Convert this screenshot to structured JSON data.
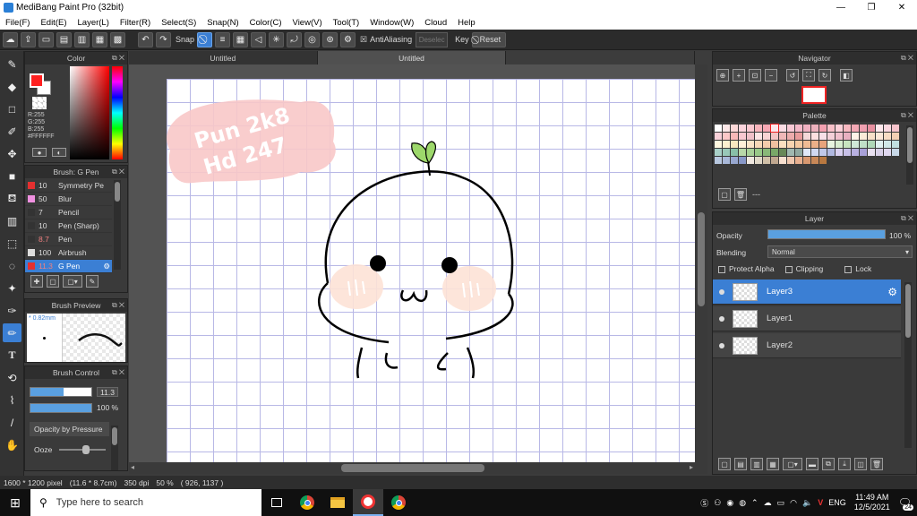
{
  "window": {
    "title": "MediBang Paint Pro (32bit)",
    "controls": [
      "—",
      "❐",
      "✕"
    ]
  },
  "menu": [
    "File(F)",
    "Edit(E)",
    "Layer(L)",
    "Filter(R)",
    "Select(S)",
    "Snap(N)",
    "Color(C)",
    "View(V)",
    "Tool(T)",
    "Window(W)",
    "Cloud",
    "Help"
  ],
  "toolbar": {
    "snap_label": "Snap",
    "antialias_label": "AntiAliasing",
    "deselect_label": "Deselec",
    "key_label": "Key",
    "reset_label": "Reset"
  },
  "tabs": [
    "Untitled",
    "Untitled"
  ],
  "color_panel": {
    "title": "Color",
    "r": "R:255",
    "g": "G:255",
    "b": "B:255",
    "hex": "#FFFFFF",
    "primary": "#ff2020",
    "secondary": "#ffffff"
  },
  "brush_panel": {
    "title": "Brush: G Pen",
    "brushes": [
      {
        "size": "10",
        "name": "Symmetry Pe",
        "color": "#e53030"
      },
      {
        "size": "50",
        "name": "Blur",
        "color": "#f090e0"
      },
      {
        "size": "7",
        "name": "Pencil",
        "color": "#333333"
      },
      {
        "size": "10",
        "name": "Pen (Sharp)",
        "color": "#333333"
      },
      {
        "size": "8.7",
        "name": "Pen",
        "color": "#333333"
      },
      {
        "size": "100",
        "name": "Airbrush",
        "color": "#dddddd"
      },
      {
        "size": "11.3",
        "name": "G Pen",
        "color": "#e53030"
      }
    ]
  },
  "brush_preview": {
    "title": "Brush Preview",
    "size": "* 0.82mm"
  },
  "brush_control": {
    "title": "Brush Control",
    "size_value": "11.3",
    "size_fraction": 0.55,
    "opacity_value": "100 %",
    "opacity_fraction": 1.0,
    "pressure_label": "Opacity by Pressure",
    "ooze_label": "Ooze"
  },
  "canvas_art": {
    "line1": "Pun 2k8",
    "line2": "Hd 247"
  },
  "navigator": {
    "title": "Navigator"
  },
  "palette": {
    "title": "Palette",
    "name": "---",
    "colors": [
      "#ffffff",
      "#fde8e8",
      "#fdd8d8",
      "#fcd4dc",
      "#fbc8d0",
      "#f9b4bc",
      "#f8a8b4",
      "#fce8ec",
      "#fcdce4",
      "#f8c8d4",
      "#f4b8c8",
      "#f0b0c0",
      "#ecb0bc",
      "#f4a0b0",
      "#f8c0c8",
      "#fcd0d8",
      "#f8b8c0",
      "#f4a8b4",
      "#f0a0b0",
      "#e890a0",
      "#ffe8ec",
      "#fcd8e0",
      "#f8c4cc",
      "#f8d0d8",
      "#fcc8c8",
      "#f8b8b8",
      "#f8c8d0",
      "#f0c0c8",
      "#fce4e4",
      "#f8d4d4",
      "#f4c4c4",
      "#f0b8b8",
      "#ecacac",
      "#e89c9c",
      "#f4d8d8",
      "#fce0e0",
      "#f8e0e8",
      "#f4d0d8",
      "#f0c0cc",
      "#e8b0c0",
      "#fff4e8",
      "#fcecd8",
      "#f8e0c8",
      "#fce8d8",
      "#f8dcc4",
      "#f4d0b4",
      "#fff8e0",
      "#fcf0d0",
      "#f8e8c0",
      "#fff0d8",
      "#fce4c8",
      "#f8d8b8",
      "#f4ccac",
      "#f0c0a0",
      "#fce0c0",
      "#f8d4b0",
      "#f4c8a0",
      "#f0bc94",
      "#ecb088",
      "#e8a47c",
      "#e8f4e0",
      "#d8ecd0",
      "#c8e4c0",
      "#d0e8d8",
      "#c0e0c8",
      "#b0d8b8",
      "#e0f0f0",
      "#d0e8e8",
      "#c0e0e0",
      "#a8d0c8",
      "#98c8b8",
      "#88c0a8",
      "#b8d8a8",
      "#a8d098",
      "#98c888",
      "#88b878",
      "#78a868",
      "#688858",
      "#a0b8b0",
      "#90a8a0",
      "#e0e8f8",
      "#d0d8f0",
      "#c0c8e8",
      "#b0b8e0",
      "#d8d0f0",
      "#c8c0e8",
      "#b8b0e0",
      "#a8a0d8",
      "#e8e0f0",
      "#d8d0e8",
      "#e0d8f0",
      "#c8d8e8",
      "#b8c8e0",
      "#a8b8d8",
      "#98a8d0",
      "#8898c8",
      "#f0e8e0",
      "#e0d8c8",
      "#d0c0a8",
      "#c0a890",
      "#f8e0d0",
      "#f0c8b0",
      "#e8b090",
      "#d89870",
      "#c88858",
      "#b87840"
    ]
  },
  "layer_panel": {
    "title": "Layer",
    "opacity_label": "Opacity",
    "opacity_value": "100 %",
    "opacity_fraction": 1.0,
    "blending_label": "Blending",
    "blending_value": "Normal",
    "protect_alpha": "Protect Alpha",
    "clipping": "Clipping",
    "lock": "Lock",
    "layers": [
      {
        "name": "Layer3",
        "selected": true
      },
      {
        "name": "Layer1",
        "selected": false
      },
      {
        "name": "Layer2",
        "selected": false
      }
    ]
  },
  "status": {
    "size": "1600 * 1200 pixel",
    "cm": "(11.6 * 8.7cm)",
    "dpi": "350 dpi",
    "zoom": "50 %",
    "coords": "( 926, 1137 )"
  },
  "taskbar": {
    "search_placeholder": "Type here to search",
    "lang": "ENG",
    "time": "11:49 AM",
    "date": "12/5/2021",
    "notif_count": "24"
  }
}
